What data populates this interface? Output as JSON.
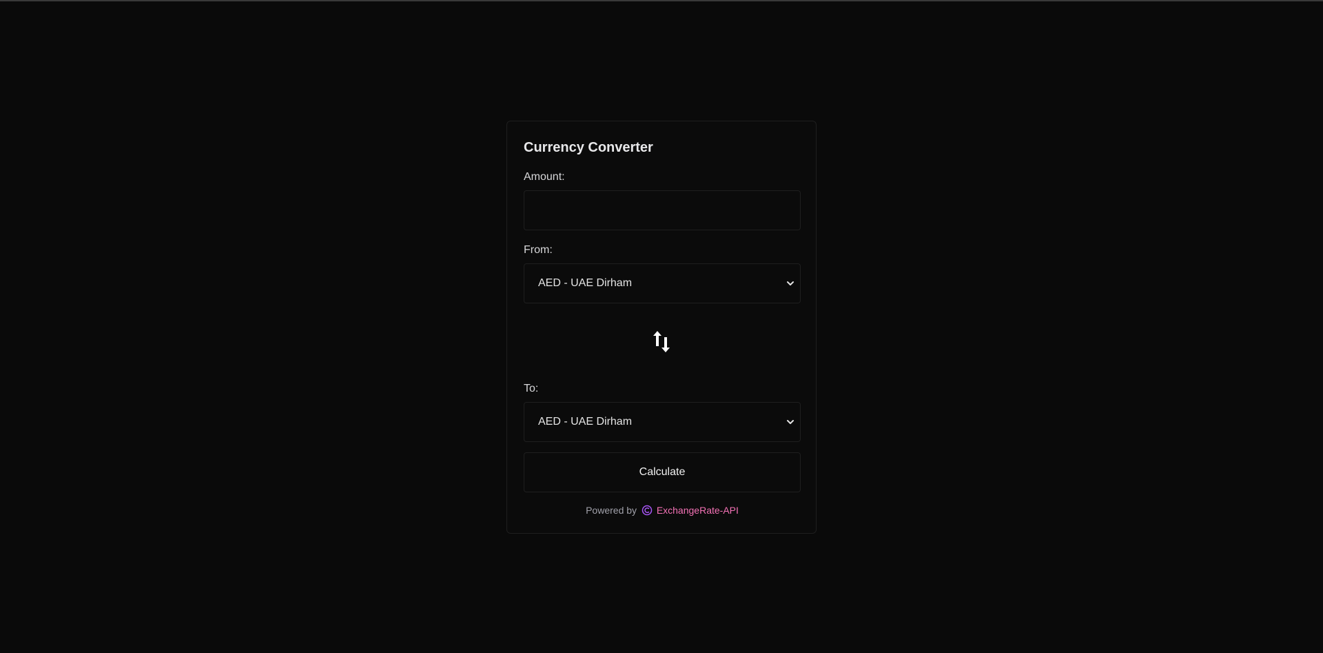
{
  "converter": {
    "title": "Currency Converter",
    "amount_label": "Amount:",
    "amount_value": "",
    "amount_placeholder": "",
    "from_label": "From:",
    "from_selected": "AED - UAE Dirham",
    "to_label": "To:",
    "to_selected": "AED - UAE Dirham",
    "swap_icon": "swap-arrows-icon",
    "calculate_label": "Calculate"
  },
  "footer": {
    "powered_text": "Powered by",
    "provider_icon": "exchangerate-logo-icon",
    "provider_name": "ExchangeRate-API"
  },
  "colors": {
    "background": "#0a0a0a",
    "border": "#1f1f1f",
    "text": "#e5e5e5",
    "muted": "#a1a1aa",
    "link": "#f472b6",
    "logo": "#a855f7"
  }
}
